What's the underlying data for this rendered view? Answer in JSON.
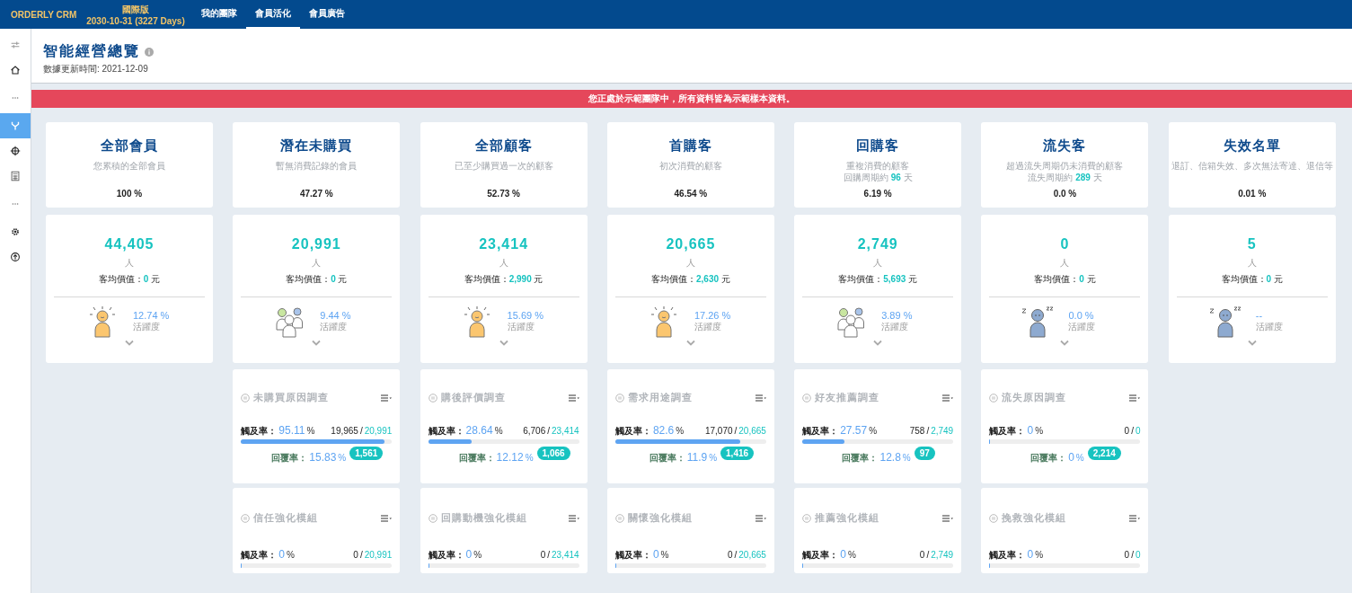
{
  "top_bar": {
    "logo": "ORDERLY CRM",
    "edition": "國際版",
    "expiry": "2030-10-31 (3227 Days)",
    "tabs": [
      {
        "label": "我的團隊",
        "selected": false
      },
      {
        "label": "會員活化",
        "selected": true
      },
      {
        "label": "會員廣告",
        "selected": false
      }
    ]
  },
  "sidebar": {
    "items": [
      {
        "kind": "sliders",
        "selected": false
      },
      {
        "kind": "home",
        "selected": false
      },
      {
        "kind": "more",
        "selected": false
      },
      {
        "kind": "branch",
        "selected": true
      },
      {
        "kind": "crosshair",
        "selected": false
      },
      {
        "kind": "calculator",
        "selected": false
      },
      {
        "kind": "more",
        "selected": false
      },
      {
        "kind": "gear",
        "selected": false
      },
      {
        "kind": "upload",
        "selected": false
      }
    ]
  },
  "header": {
    "title": "智能經營總覽",
    "updated": "數據更新時間: 2021-12-09"
  },
  "banner": "您正處於示範團隊中，所有資料皆為示範樣本資料。",
  "segments": [
    {
      "title": "全部會員",
      "desc": [
        "您累積的全部會員"
      ],
      "share": "100 %",
      "count": "44,405",
      "unit": "人",
      "avg": "客均價值：**0** 元",
      "activity": "12.74 %",
      "activity_label": "活躍度",
      "kind": "sun"
    },
    {
      "title": "潛在未購買",
      "desc": [
        "暫無消費記錄的會員"
      ],
      "share": "47.27 %",
      "count": "20,991",
      "unit": "人",
      "avg": "客均價值：**0** 元",
      "activity": "9.44 %",
      "activity_label": "活躍度",
      "kind": "pair"
    },
    {
      "title": "全部顧客",
      "desc": [
        "已至少購買過一次的顧客"
      ],
      "share": "52.73 %",
      "count": "23,414",
      "unit": "人",
      "avg": "客均價值：**2,990** 元",
      "activity": "15.69 %",
      "activity_label": "活躍度",
      "kind": "sun"
    },
    {
      "title": "首購客",
      "desc": [
        "初次消費的顧客"
      ],
      "share": "46.54 %",
      "count": "20,665",
      "unit": "人",
      "avg": "客均價值：**2,630** 元",
      "activity": "17.26 %",
      "activity_label": "活躍度",
      "kind": "sun"
    },
    {
      "title": "回購客",
      "desc": [
        "重複消費的顧客",
        "回購周期約 **96** 天"
      ],
      "share": "6.19 %",
      "count": "2,749",
      "unit": "人",
      "avg": "客均價值：**5,693** 元",
      "activity": "3.89 %",
      "activity_label": "活躍度",
      "kind": "pair"
    },
    {
      "title": "流失客",
      "desc": [
        "超過流失周期仍未消費的顧客",
        "流失周期約 **289** 天"
      ],
      "share": "0.0 %",
      "count": "0",
      "unit": "人",
      "avg": "客均價值：**0** 元",
      "activity": "0.0 %",
      "activity_label": "活躍度",
      "kind": "sleep"
    },
    {
      "title": "失效名單",
      "desc": [
        "退訂、信箱失效、多次無法寄達、退信等"
      ],
      "share": "0.01 %",
      "count": "5",
      "unit": "人",
      "avg": "客均價值：**0** 元",
      "activity": "--",
      "activity_label": "活躍度",
      "kind": "sleep"
    }
  ],
  "surveys": [
    {
      "kind": "survey",
      "title": "未購買原因調查",
      "reach_label": "觸及率：",
      "reach": "95.11",
      "reach_unit": "%",
      "reached": "19,965",
      "separator": "/",
      "total": "20,991",
      "level": 0.9511,
      "reply_label": "回覆率：",
      "reply": "15.83",
      "reply_unit": "%",
      "replies": "1,561"
    },
    {
      "kind": "survey",
      "title": "購後評價調查",
      "reach_label": "觸及率：",
      "reach": "28.64",
      "reach_unit": "%",
      "reached": "6,706",
      "separator": "/",
      "total": "23,414",
      "level": 0.2864,
      "reply_label": "回覆率：",
      "reply": "12.12",
      "reply_unit": "%",
      "replies": "1,066"
    },
    {
      "kind": "survey",
      "title": "需求用途調查",
      "reach_label": "觸及率：",
      "reach": "82.6",
      "reach_unit": "%",
      "reached": "17,070",
      "separator": "/",
      "total": "20,665",
      "level": 0.826,
      "reply_label": "回覆率：",
      "reply": "11.9",
      "reply_unit": "%",
      "replies": "1,416"
    },
    {
      "kind": "survey",
      "title": "好友推薦調查",
      "reach_label": "觸及率：",
      "reach": "27.57",
      "reach_unit": "%",
      "reached": "758",
      "separator": "/",
      "total": "2,749",
      "level": 0.2757,
      "reply_label": "回覆率：",
      "reply": "12.8",
      "reply_unit": "%",
      "replies": "97"
    },
    {
      "kind": "survey",
      "title": "流失原因調查",
      "reach_label": "觸及率：",
      "reach": "0",
      "reach_unit": "%",
      "reached": "0",
      "separator": "/",
      "total": "0",
      "level": 0,
      "reply_label": "回覆率：",
      "reply": "0",
      "reply_unit": "%",
      "replies": "2,214"
    },
    {
      "kind": "module",
      "title": "信任強化模組",
      "reach_label": "觸及率：",
      "reach": "0",
      "reach_unit": "%",
      "reached": "0",
      "separator": "/",
      "total": "20,991",
      "level": 0
    },
    {
      "kind": "module",
      "title": "回購動機強化模組",
      "reach_label": "觸及率：",
      "reach": "0",
      "reach_unit": "%",
      "reached": "0",
      "separator": "/",
      "total": "23,414",
      "level": 0
    },
    {
      "kind": "module",
      "title": "關懷強化模組",
      "reach_label": "觸及率：",
      "reach": "0",
      "reach_unit": "%",
      "reached": "0",
      "separator": "/",
      "total": "20,665",
      "level": 0
    },
    {
      "kind": "module",
      "title": "推薦強化模組",
      "reach_label": "觸及率：",
      "reach": "0",
      "reach_unit": "%",
      "reached": "0",
      "separator": "/",
      "total": "2,749",
      "level": 0
    },
    {
      "kind": "module",
      "title": "挽救強化模組",
      "reach_label": "觸及率：",
      "reach": "0",
      "reach_unit": "%",
      "reached": "0",
      "separator": "/",
      "total": "0",
      "level": 0
    }
  ]
}
